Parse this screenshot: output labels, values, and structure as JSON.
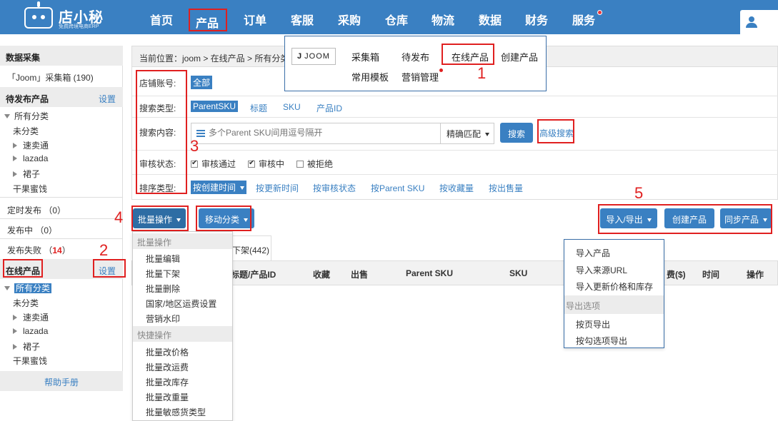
{
  "brand": {
    "name": "店小秘",
    "tagline": "免费跨境电商ERP"
  },
  "nav": [
    "首页",
    "产品",
    "订单",
    "客服",
    "采购",
    "仓库",
    "物流",
    "数据",
    "财务",
    "服务"
  ],
  "sidebar": {
    "collect_title": "数据采集",
    "collect_item": "「Joom」采集箱 (190)",
    "pending_title": "待发布产品",
    "pending_settings": "设置",
    "pending_tree": {
      "all": "所有分类",
      "uncat": "未分类",
      "c1": "速卖通",
      "c2": "lazada",
      "c3": "裙子",
      "c4": "干果蜜饯"
    },
    "scheduled": "定时发布 （0）",
    "publishing": "发布中 （0）",
    "failed_label": "发布失败 （",
    "failed_count": "14",
    "failed_end": "）",
    "online_title": "在线产品",
    "online_settings": "设置",
    "online_tree": {
      "all": "所有分类",
      "uncat": "未分类",
      "c1": "速卖通",
      "c2": "lazada",
      "c3": "裙子",
      "c4": "干果蜜饯"
    },
    "help": "帮助手册"
  },
  "breadcrumb": "当前位置：joom > 在线产品 > 所有分类",
  "filters": {
    "store_label": "店铺账号:",
    "store_all": "全部",
    "search_type_label": "搜索类型:",
    "search_types": [
      "ParentSKU",
      "标题",
      "SKU",
      "产品ID"
    ],
    "search_content_label": "搜索内容:",
    "search_placeholder": "多个Parent SKU间用逗号隔开",
    "match_mode": "精确匹配",
    "search_btn": "搜索",
    "advanced": "高级搜索",
    "review_label": "审核状态:",
    "review_opts": [
      "审核通过",
      "审核中",
      "被拒绝"
    ],
    "sort_label": "排序类型:",
    "sort_opts": [
      "按创建时间",
      "按更新时间",
      "按审核状态",
      "按Parent SKU",
      "按收藏量",
      "按出售量"
    ]
  },
  "toolbar": {
    "batch": "批量操作",
    "move": "移动分类",
    "import_export": "导入/导出",
    "create": "创建产品",
    "sync": "同步产品"
  },
  "tab_label": "下架(442)",
  "table_headers": [
    "标题/产品ID",
    "收藏",
    "出售",
    "Parent SKU",
    "SKU",
    "费($)",
    "时间",
    "操作"
  ],
  "batch_menu": {
    "group1": "批量操作",
    "items1": [
      "批量编辑",
      "批量下架",
      "批量删除",
      "国家/地区运费设置",
      "营销水印"
    ],
    "group2": "快捷操作",
    "items2": [
      "批量改价格",
      "批量改运费",
      "批量改库存",
      "批量改重量",
      "批量敏感货类型"
    ]
  },
  "import_menu": {
    "items1": [
      "导入产品",
      "导入来源URL",
      "导入更新价格和库存"
    ],
    "group": "导出选项",
    "items2": [
      "按页导出",
      "按勾选项导出"
    ]
  },
  "popup": {
    "platform": "JOOM",
    "row1": [
      "采集箱",
      "待发布",
      "在线产品",
      "创建产品"
    ],
    "row2": [
      "常用模板",
      "营销管理"
    ]
  },
  "annotations": [
    "1",
    "2",
    "3",
    "4",
    "5"
  ],
  "colors": {
    "primary": "#3a80c2",
    "annotation": "#e02020",
    "failed": "#e02020"
  }
}
